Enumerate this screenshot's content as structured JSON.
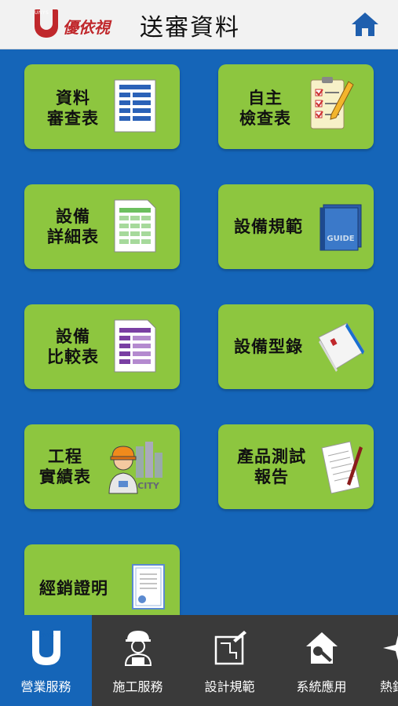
{
  "header": {
    "title": "送審資料",
    "logo_text": "優依視",
    "logo_mark": "UNYS"
  },
  "tiles": [
    {
      "label": "資料\n審查表",
      "icon": "form-document-icon"
    },
    {
      "label": "自主\n檢查表",
      "icon": "checklist-pencil-icon"
    },
    {
      "label": "設備\n詳細表",
      "icon": "spreadsheet-icon"
    },
    {
      "label": "設備規範",
      "icon": "guide-book-icon",
      "icon_text": "GUIDE"
    },
    {
      "label": "設備\n比較表",
      "icon": "purple-table-icon"
    },
    {
      "label": "設備型錄",
      "icon": "catalog-icon"
    },
    {
      "label": "工程\n實績表",
      "icon": "engineer-city-icon",
      "icon_text": "CITY"
    },
    {
      "label": "產品測試\n報告",
      "icon": "report-pen-icon"
    },
    {
      "label": "經銷證明",
      "icon": "certificate-icon"
    }
  ],
  "tabs": [
    {
      "label": "營業服務",
      "icon": "unys-logo-icon",
      "active": true
    },
    {
      "label": "施工服務",
      "icon": "worker-icon"
    },
    {
      "label": "設計規範",
      "icon": "blueprint-icon"
    },
    {
      "label": "系統應用",
      "icon": "house-wrench-icon"
    },
    {
      "label": "熱銷",
      "icon": "sparkle-icon"
    }
  ],
  "colors": {
    "tile": "#8dc63f",
    "background": "#1565b8",
    "tabbar": "#3a3a3a",
    "brand_red": "#c0282c"
  }
}
